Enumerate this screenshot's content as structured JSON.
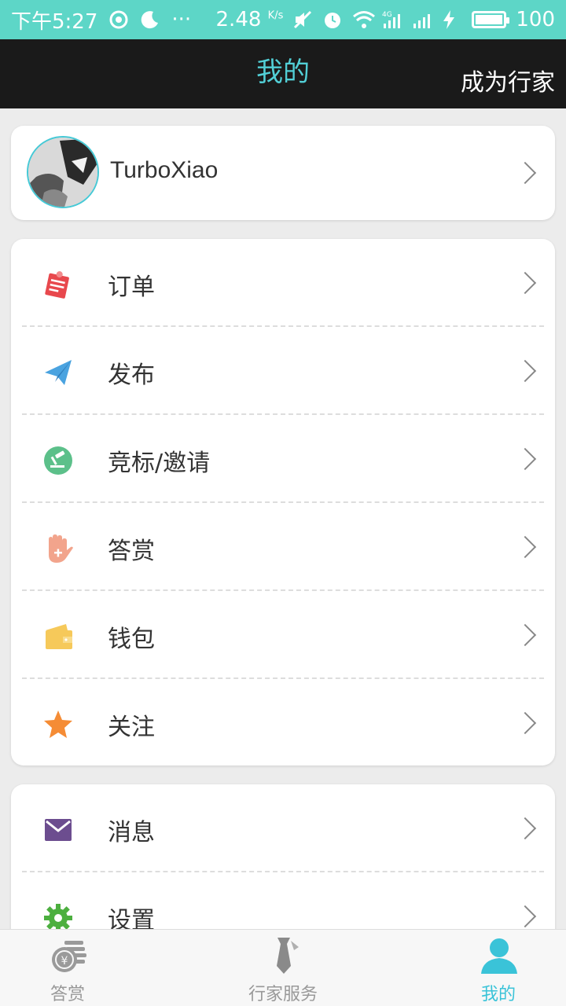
{
  "status_bar": {
    "time": "下午5:27",
    "more": "···",
    "speed": "2.48",
    "speed_unit": "K/s",
    "network": "4G",
    "battery": "100"
  },
  "header": {
    "title": "我的",
    "action": "成为行家"
  },
  "profile": {
    "username": "TurboXiao"
  },
  "menu_group_1": [
    {
      "label": "订单",
      "icon": "order-icon",
      "color": "#e8484d"
    },
    {
      "label": "发布",
      "icon": "paper-plane-icon",
      "color": "#4aa3e0"
    },
    {
      "label": "竞标/邀请",
      "icon": "gavel-icon",
      "color": "#5cc08a"
    },
    {
      "label": "答赏",
      "icon": "hand-icon",
      "color": "#f2a48c"
    },
    {
      "label": "钱包",
      "icon": "wallet-icon",
      "color": "#f6c95a"
    },
    {
      "label": "关注",
      "icon": "star-icon",
      "color": "#f58c35"
    }
  ],
  "menu_group_2": [
    {
      "label": "消息",
      "icon": "mail-icon",
      "color": "#6c4d8f"
    },
    {
      "label": "设置",
      "icon": "gear-icon",
      "color": "#4caf3f"
    }
  ],
  "bottom_nav": [
    {
      "label": "答赏",
      "icon": "coins-icon",
      "active": false
    },
    {
      "label": "行家服务",
      "icon": "tie-icon",
      "active": false
    },
    {
      "label": "我的",
      "icon": "person-icon",
      "active": true
    }
  ],
  "colors": {
    "status_bar": "#5dd6c7",
    "title_bar": "#1a1a1a",
    "accent": "#3ac3d8"
  }
}
